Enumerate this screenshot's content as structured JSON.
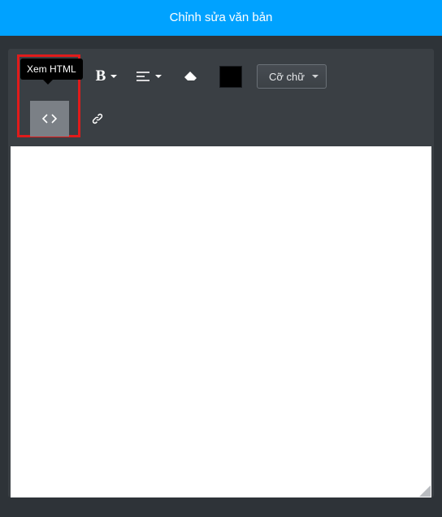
{
  "header": {
    "title": "Chỉnh sửa văn bản"
  },
  "toolbar": {
    "tooltip_html": "Xem HTML",
    "bold_label": "B",
    "fontsize_label": "Cỡ chữ",
    "color_value": "#000000"
  }
}
